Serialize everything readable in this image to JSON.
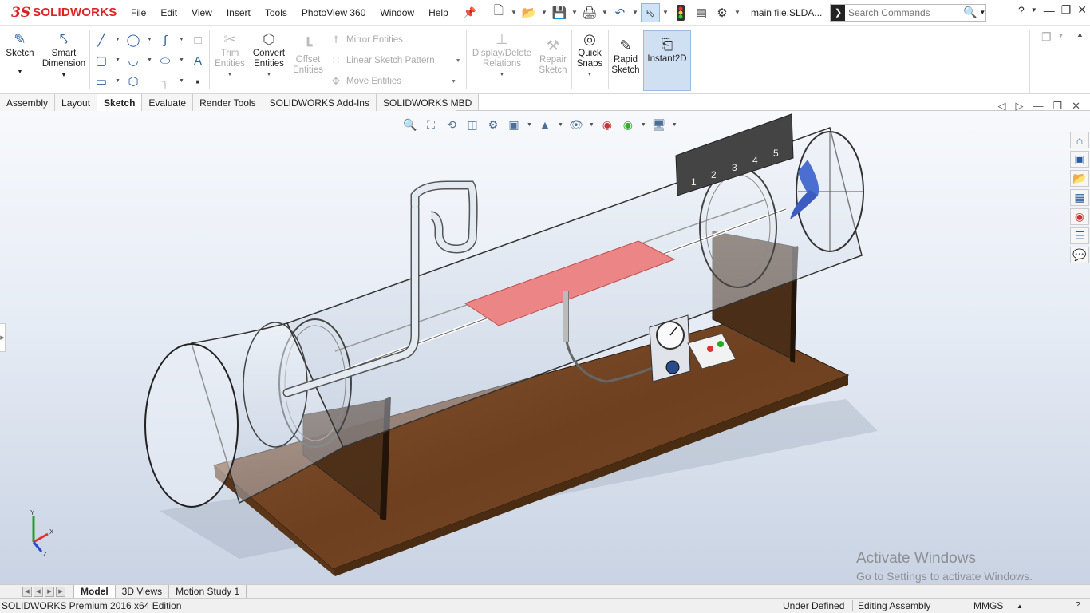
{
  "app": {
    "logo_ds": "3S",
    "logo_text": "SOLIDWORKS",
    "document_name": "main file.SLDA...",
    "accent_color": "#d22222"
  },
  "menu": [
    "File",
    "Edit",
    "View",
    "Insert",
    "Tools",
    "PhotoView 360",
    "Window",
    "Help"
  ],
  "search": {
    "placeholder": "Search Commands",
    "icon": "command-prompt-icon"
  },
  "window_controls": [
    "help-icon",
    "minimize-icon",
    "restore-icon",
    "close-icon"
  ],
  "ribbon": {
    "sketch": "Sketch",
    "smart_dimension": "Smart Dimension",
    "trim_entities": "Trim Entities",
    "convert_entities": "Convert Entities",
    "offset_entities": "Offset Entities",
    "mirror_entities": "Mirror Entities",
    "linear_sketch_pattern": "Linear Sketch Pattern",
    "move_entities": "Move Entities",
    "display_delete_relations": "Display/Delete Relations",
    "repair_sketch": "Repair Sketch",
    "quick_snaps": "Quick Snaps",
    "rapid_sketch": "Rapid Sketch",
    "instant2d": "Instant2D"
  },
  "tabs": [
    "Assembly",
    "Layout",
    "Sketch",
    "Evaluate",
    "Render Tools",
    "SOLIDWORKS Add-Ins",
    "SOLIDWORKS MBD"
  ],
  "active_tab": "Sketch",
  "bottom_tabs": [
    "Model",
    "3D Views",
    "Motion Study 1"
  ],
  "active_bottom_tab": "Model",
  "status": {
    "edition": "SOLIDWORKS Premium 2016 x64 Edition",
    "definition": "Under Defined",
    "mode": "Editing Assembly",
    "units": "MMGS"
  },
  "watermark": {
    "line1": "Activate Windows",
    "line2": "Go to Settings to activate Windows."
  },
  "axis": {
    "x": "X",
    "y": "Y",
    "z": "Z"
  },
  "model": {
    "manometer_labels": [
      "1",
      "2",
      "3",
      "4",
      "5"
    ],
    "colors": {
      "base": "#7a4a24",
      "plate": "#ec8585",
      "tube": "#d8e2ee",
      "fan": "#4b6ed1"
    }
  }
}
